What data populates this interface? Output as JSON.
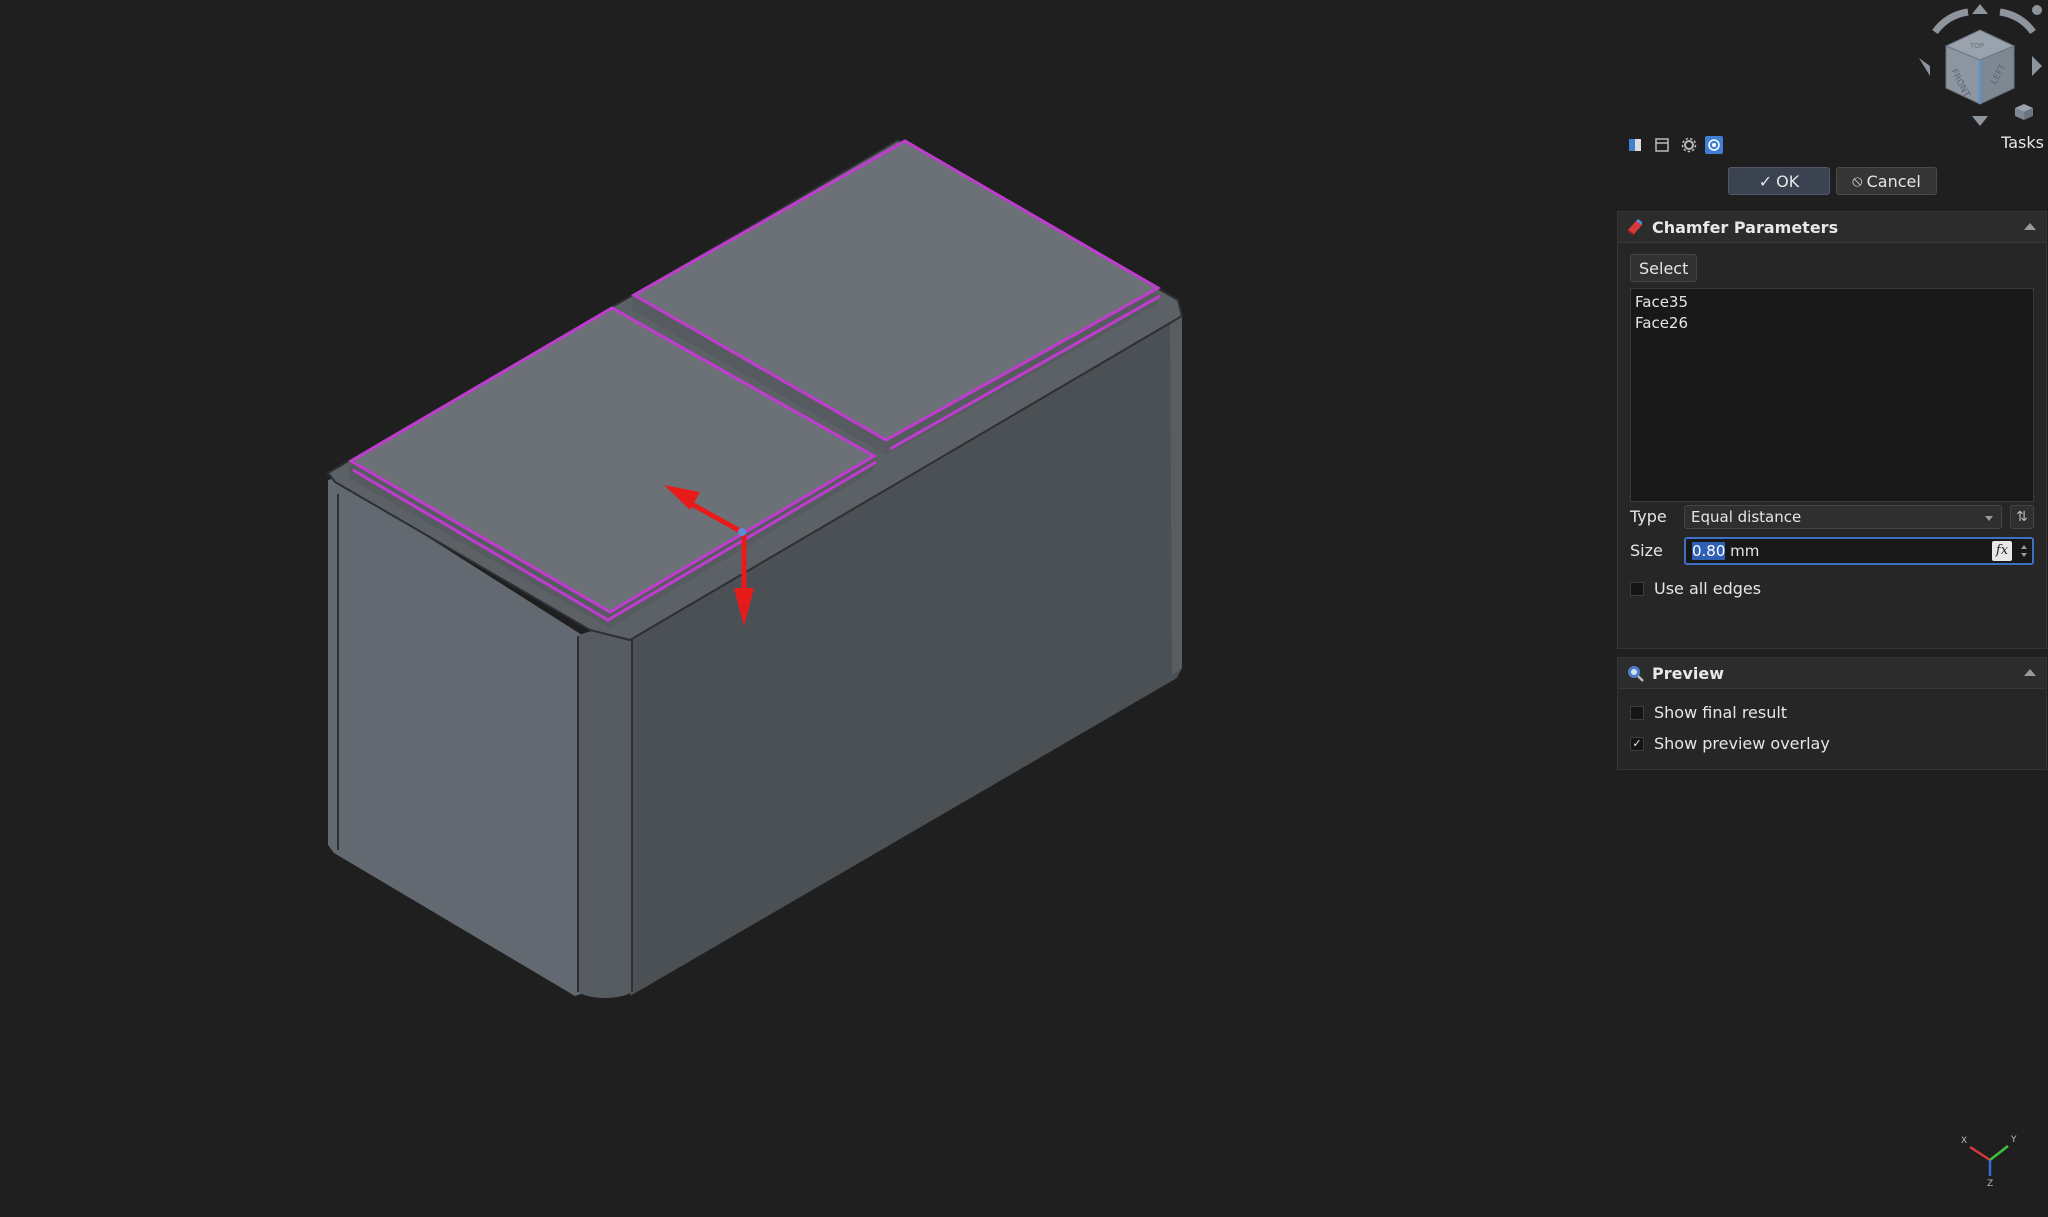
{
  "panel": {
    "tasks_label": "Tasks",
    "ok_label": "OK",
    "cancel_label": "Cancel",
    "toolbar_icons": [
      "model-tab-icon",
      "properties-tab-icon",
      "settings-tab-icon",
      "tasks-tab-icon"
    ]
  },
  "chamfer": {
    "title": "Chamfer Parameters",
    "select_label": "Select",
    "faces": [
      "Face35",
      "Face26"
    ],
    "type_label": "Type",
    "type_value": "Equal distance",
    "size_label": "Size",
    "size_value": "0.80",
    "size_unit": " mm",
    "fx_label": "fx",
    "use_all_edges_label": "Use all edges",
    "use_all_edges_checked": false
  },
  "preview": {
    "title": "Preview",
    "show_final_label": "Show final result",
    "show_final_checked": false,
    "show_overlay_label": "Show preview overlay",
    "show_overlay_checked": true
  },
  "navcube": {
    "faces": [
      "FRONT",
      "LEFT",
      "TOP"
    ]
  },
  "axes": {
    "x": "X",
    "y": "Y",
    "z": "Z"
  },
  "colors": {
    "background": "#1f1f1f",
    "highlight": "#c03ccf",
    "gizmo": "#e81b1b",
    "top_face": "#6a7075",
    "side_left": "#60666b",
    "side_right": "#4a4f54"
  }
}
